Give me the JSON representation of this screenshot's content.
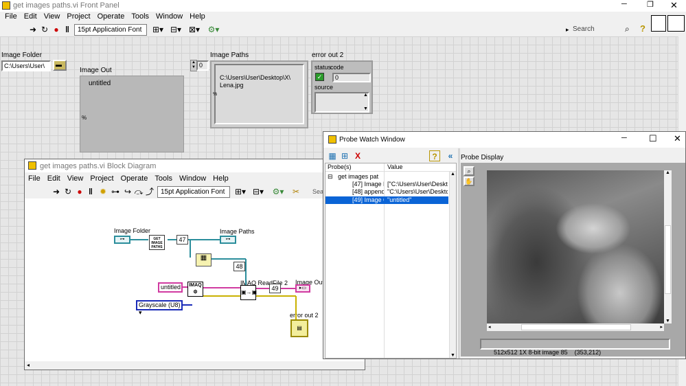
{
  "front_panel": {
    "title": "get images paths.vi Front Panel",
    "menu": [
      "File",
      "Edit",
      "View",
      "Project",
      "Operate",
      "Tools",
      "Window",
      "Help"
    ],
    "font_dropdown": "15pt Application Font",
    "search_placeholder": "Search",
    "image_folder": {
      "label": "Image Folder",
      "value": "C:\\Users\\User\\"
    },
    "image_out": {
      "label": "Image Out",
      "value": "untitled"
    },
    "image_paths": {
      "label": "Image Paths",
      "index": "0",
      "value": "C:\\Users\\User\\Desktop\\X\\\nLena.jpg"
    },
    "error_out": {
      "label": "error out 2",
      "status_label": "status",
      "code_label": "code",
      "code_value": "0",
      "source_label": "source"
    }
  },
  "block_diagram": {
    "title": "get images paths.vi Block Diagram",
    "menu": [
      "File",
      "Edit",
      "View",
      "Project",
      "Operate",
      "Tools",
      "Window",
      "Help"
    ],
    "font_dropdown": "15pt Application Font",
    "search_placeholder": "Sea",
    "labels": {
      "image_folder": "Image Folder",
      "image_paths": "Image Paths",
      "get_image_paths": "GET\nIMAGE\nPATHS",
      "probe_47": "47",
      "probe_48": "48",
      "probe_49": "49",
      "untitled": "untitled",
      "imaq": "IMAQ",
      "imaq_readfile": "IMAQ ReadFile 2",
      "image_out": "Image Out",
      "grayscale": "Grayscale (U8)",
      "error_out": "error out 2"
    }
  },
  "probe_window": {
    "title": "Probe Watch Window",
    "col_probes": "Probe(s)",
    "col_value": "Value",
    "tree_root": "get images pat",
    "rows": [
      {
        "probe": "[47] Image F",
        "value": "[\"C:\\Users\\User\\Deskt"
      },
      {
        "probe": "[48] append",
        "value": "\"C:\\Users\\User\\Deskto"
      },
      {
        "probe": "[49] Image C",
        "value": "\"untitled\""
      }
    ],
    "display_label": "Probe Display",
    "status_info": "512x512 1X 8-bit image 85    (353,212)"
  },
  "colors": {
    "accent": "#3b73c8",
    "selection": "#0a64d6",
    "teal": "#2a8d9b",
    "pink": "#d03aa0",
    "orange": "#c47a14"
  }
}
